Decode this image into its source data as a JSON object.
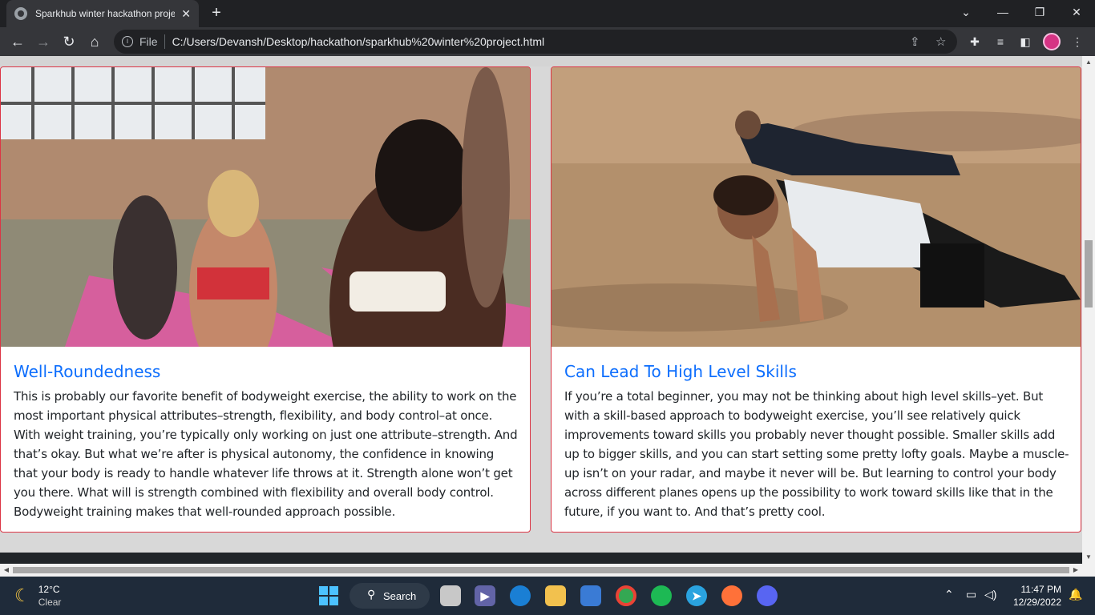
{
  "browser": {
    "tab_title": "Sparkhub winter hackathon proje",
    "tab_close": "✕",
    "new_tab": "+",
    "address_label": "File",
    "url": "C:/Users/Devansh/Desktop/hackathon/sparkhub%20winter%20project.html",
    "window_controls": {
      "dropdown": "⌄",
      "minimize": "—",
      "restore": "❐",
      "close": "✕"
    }
  },
  "cards": [
    {
      "title": "Well-Roundedness",
      "body": "This is probably our favorite benefit of bodyweight exercise, the ability to work on the most important physical attributes–strength, flexibility, and body control–at once. With weight training, you’re typically only working on just one attribute–strength. And that’s okay. But what we’re after is physical autonomy, the confidence in knowing that your body is ready to handle whatever life throws at it. Strength alone won’t get you there. What will is strength combined with flexibility and overall body control. Bodyweight training makes that well-rounded approach possible."
    },
    {
      "title": "Can Lead To High Level Skills",
      "body": "If you’re a total beginner, you may not be thinking about high level skills–yet. But with a skill-based approach to bodyweight exercise, you’ll see relatively quick improvements toward skills you probably never thought possible. Smaller skills add up to bigger skills, and you can start setting some pretty lofty goals. Maybe a muscle-up isn’t on your radar, and maybe it never will be. But learning to control your body across different planes opens up the possibility to work toward skills like that in the future, if you want to. And that’s pretty cool."
    }
  ],
  "taskbar": {
    "temperature": "12°C",
    "condition": "Clear",
    "search_label": "Search",
    "time": "11:47 PM",
    "date": "12/29/2022"
  },
  "colors": {
    "card_border": "#dc3545",
    "heading": "#0d6efd",
    "taskbar": "#1f2b3a"
  }
}
